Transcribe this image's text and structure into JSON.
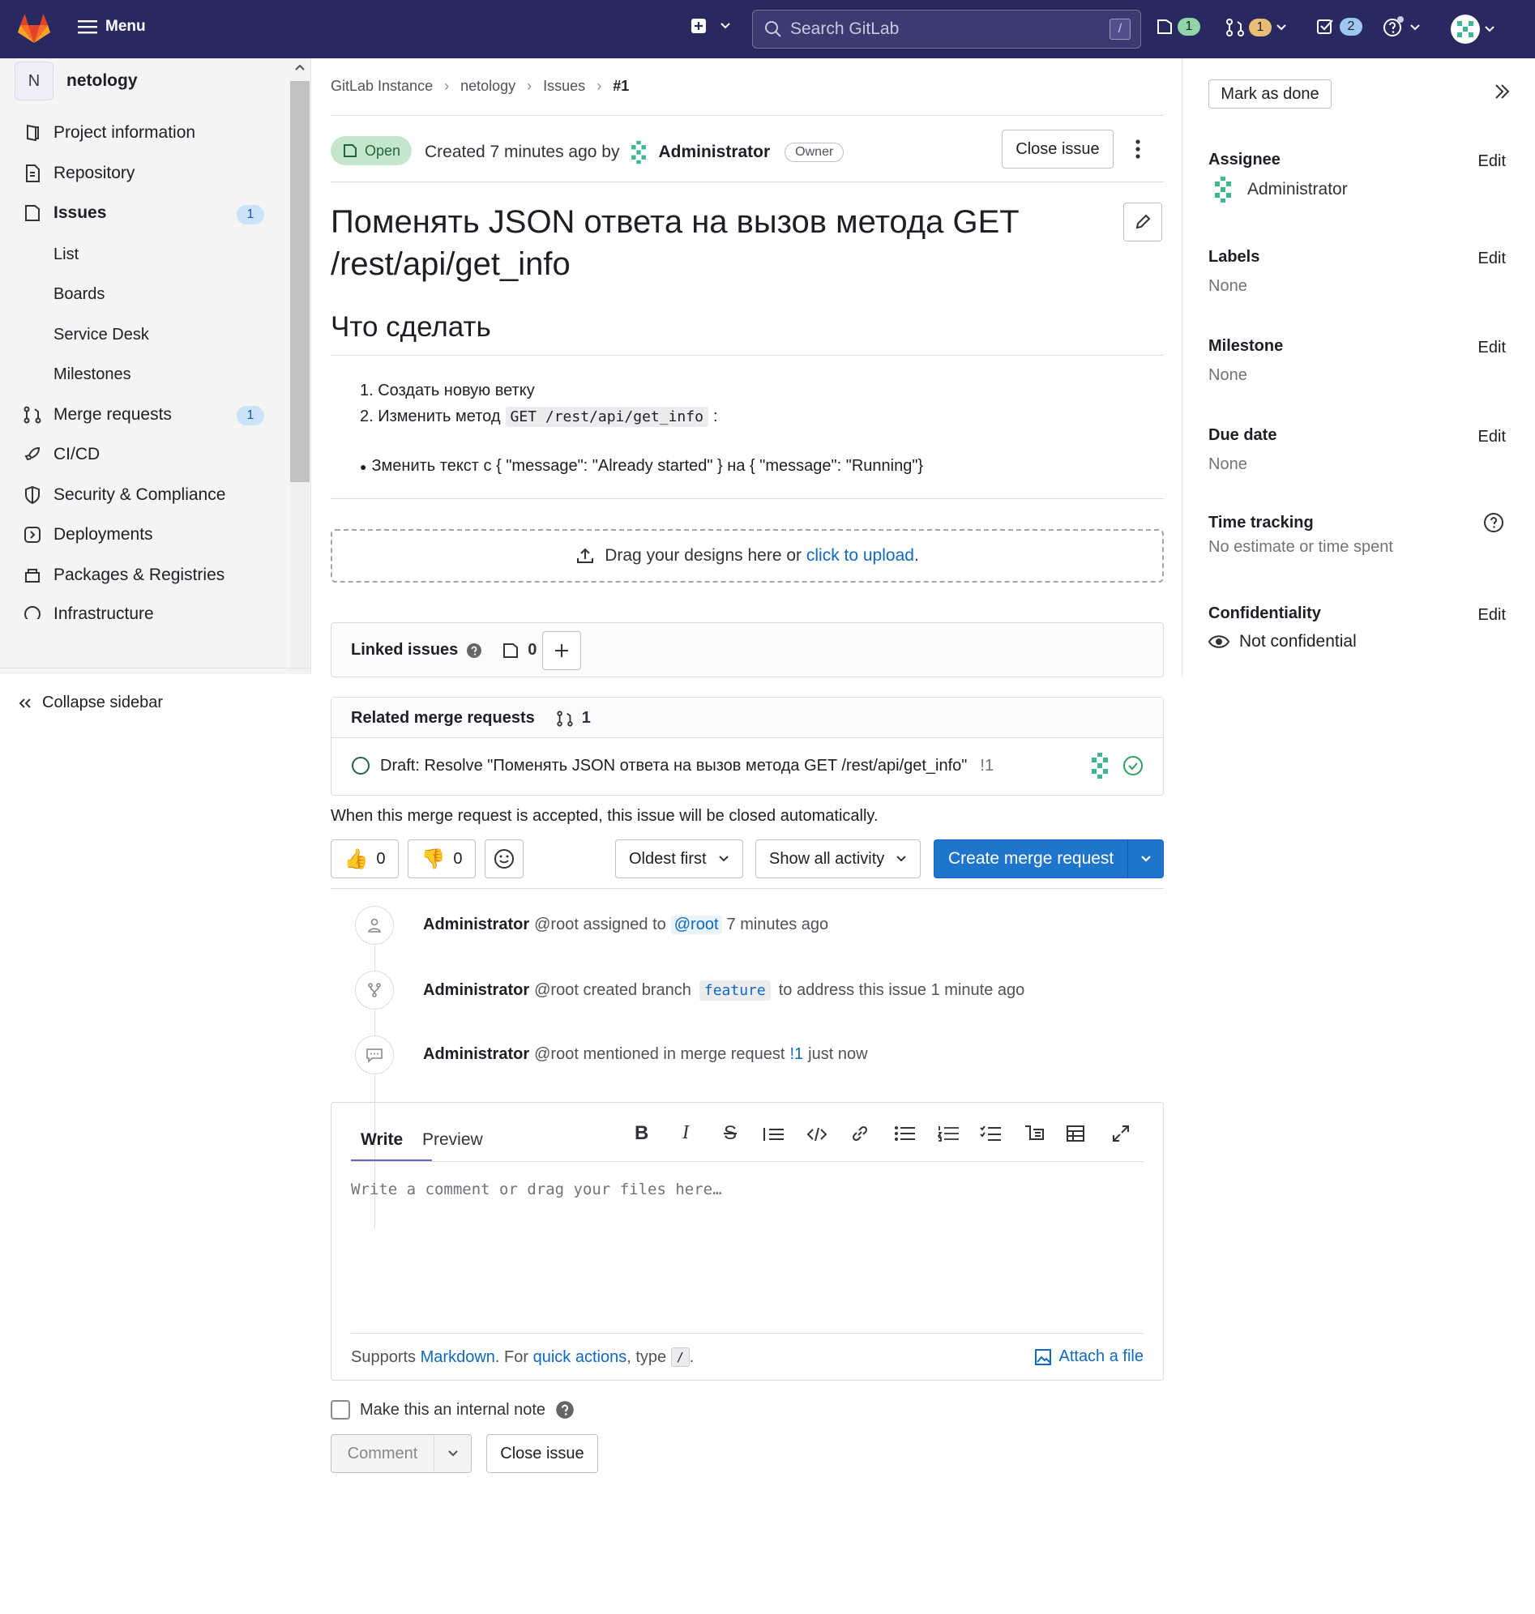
{
  "topbar": {
    "menu_label": "Menu",
    "search_placeholder": "Search GitLab",
    "search_shortcut": "/",
    "issues_count": "1",
    "mr_count": "1",
    "todos_count": "2"
  },
  "sidebar": {
    "project_initial": "N",
    "project_name": "netology",
    "items": [
      {
        "label": "Project information"
      },
      {
        "label": "Repository"
      },
      {
        "label": "Issues",
        "badge": "1"
      },
      {
        "label": "List"
      },
      {
        "label": "Boards"
      },
      {
        "label": "Service Desk"
      },
      {
        "label": "Milestones"
      },
      {
        "label": "Merge requests",
        "badge": "1"
      },
      {
        "label": "CI/CD"
      },
      {
        "label": "Security & Compliance"
      },
      {
        "label": "Deployments"
      },
      {
        "label": "Packages & Registries"
      },
      {
        "label": "Infrastructure"
      }
    ],
    "collapse_label": "Collapse sidebar"
  },
  "breadcrumb": [
    "GitLab Instance",
    "netology",
    "Issues",
    "#1"
  ],
  "issue": {
    "status": "Open",
    "created_prefix": "Created 7 minutes ago by",
    "author": "Administrator",
    "author_role": "Owner",
    "close_button": "Close issue",
    "title": "Поменять JSON ответа на вызов метода GET /rest/api/get_info",
    "heading": "Что сделать",
    "list_1": "1. Создать новую ветку",
    "list_2_prefix": "2. Изменить метод",
    "list_2_code": "GET /rest/api/get_info",
    "list_2_suffix": ":",
    "bullet": "Зменить текст с { \"message\": \"Already started\" } на { \"message\": \"Running\"}"
  },
  "designs": {
    "text": "Drag your designs here or",
    "link": "click to upload",
    "suffix": "."
  },
  "linked_issues": {
    "label": "Linked issues",
    "count": "0"
  },
  "related_mrs": {
    "label": "Related merge requests",
    "count": "1",
    "item_title": "Draft: Resolve \"Поменять JSON ответа на вызов метода GET /rest/api/get_info\"",
    "item_ref": "!1",
    "note": "When this merge request is accepted, this issue will be closed automatically."
  },
  "actions": {
    "thumbs_up": "0",
    "thumbs_down": "0",
    "sort": "Oldest first",
    "filter": "Show all activity",
    "create_mr": "Create merge request"
  },
  "activity": [
    {
      "author": "Administrator",
      "text": "@root assigned to",
      "mention": "@root",
      "time": "7 minutes ago"
    },
    {
      "author": "Administrator",
      "text": "@root created branch",
      "branch": "feature",
      "text2": "to address this issue 1 minute ago"
    },
    {
      "author": "Administrator",
      "text": "@root mentioned in merge request",
      "ref": "!1",
      "time": "just now"
    }
  ],
  "editor": {
    "tab_write": "Write",
    "tab_preview": "Preview",
    "placeholder": "Write a comment or drag your files here…",
    "supports": "Supports",
    "markdown": "Markdown",
    "for": ". For",
    "quick_actions": "quick actions",
    "type": ", type",
    "slash": "/",
    "dot": ".",
    "attach": "Attach a file"
  },
  "internal_note": "Make this an internal note",
  "comment_button": "Comment",
  "close_button_bottom": "Close issue",
  "right_sidebar": {
    "mark_done": "Mark as done",
    "assignee_label": "Assignee",
    "assignee_value": "Administrator",
    "labels_label": "Labels",
    "labels_value": "None",
    "milestone_label": "Milestone",
    "milestone_value": "None",
    "due_label": "Due date",
    "due_value": "None",
    "time_label": "Time tracking",
    "time_value": "No estimate or time spent",
    "conf_label": "Confidentiality",
    "conf_value": "Not confidential",
    "edit": "Edit"
  },
  "colors": {
    "navbar": "#292961",
    "primary": "#1f75cb",
    "open_badge": "#c3e6cd",
    "link": "#1068bf"
  }
}
